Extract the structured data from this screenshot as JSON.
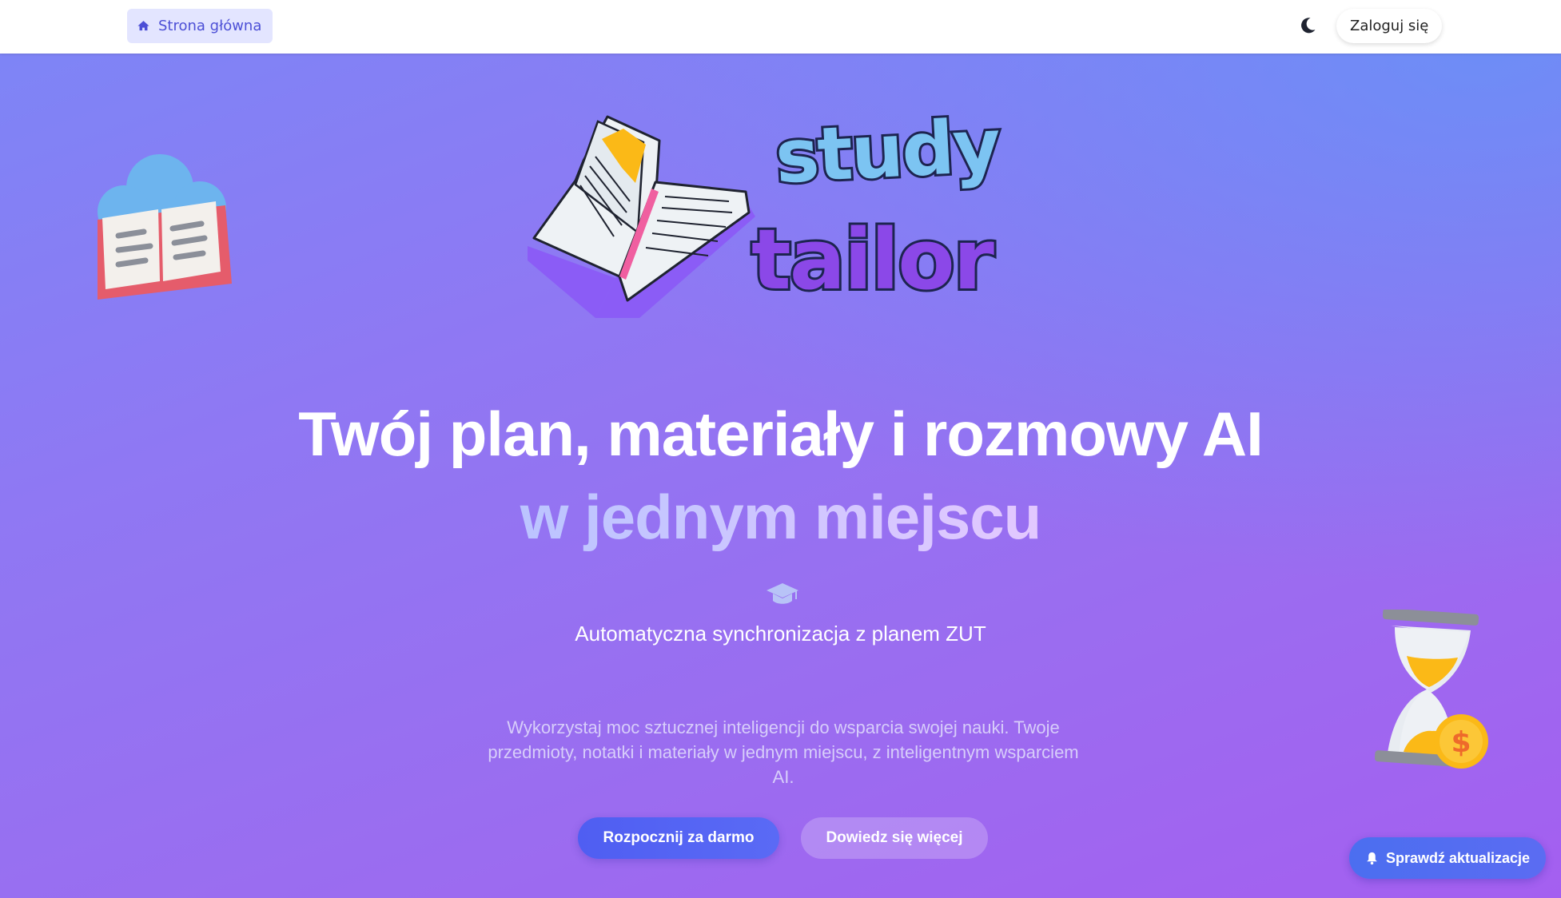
{
  "navbar": {
    "home_label": "Strona główna",
    "home_icon": "home-icon",
    "theme_icon": "moon-icon",
    "login_label": "Zaloguj się"
  },
  "logo": {
    "word_top": "study",
    "word_bottom": "tailor",
    "colors": {
      "top": "#7cc4f2",
      "bottom": "#8b48e8",
      "outline": "#1d2450"
    }
  },
  "hero": {
    "headline": "Twój plan, materiały i rozmowy AI",
    "headline_accent": "w jednym miejscu",
    "cap_icon": "graduation-cap-icon",
    "subtitle": "Automatyczna synchronizacja z planem ZUT",
    "description": "Wykorzystaj moc sztucznej inteligencji do wsparcia swojej nauki. Twoje przedmioty, notatki i materiały w jednym miejscu, z inteligentnym wsparciem AI."
  },
  "cta": {
    "primary_label": "Rozpocznij za darmo",
    "secondary_label": "Dowiedz się więcej"
  },
  "updates": {
    "label": "Sprawdź aktualizacje",
    "icon": "bell-icon"
  },
  "colors": {
    "accent": "#4f5ef2",
    "background_from": "#7c86f6",
    "background_to": "#a45ff0"
  }
}
